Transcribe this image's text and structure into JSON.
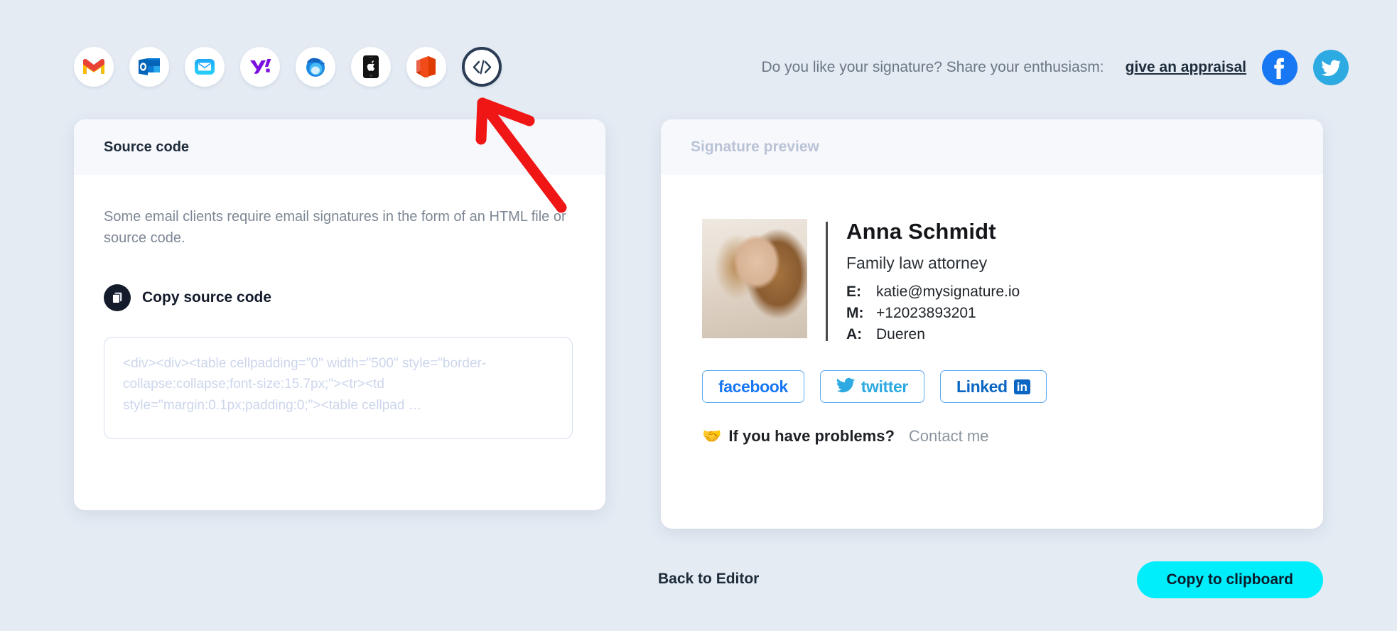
{
  "email_clients": [
    {
      "id": "gmail",
      "label": "Gmail",
      "selected": false
    },
    {
      "id": "outlook",
      "label": "Outlook",
      "selected": false
    },
    {
      "id": "apple-mail",
      "label": "Apple Mail",
      "selected": false
    },
    {
      "id": "yahoo",
      "label": "Yahoo Mail",
      "selected": false
    },
    {
      "id": "thunderbird",
      "label": "Thunderbird",
      "selected": false
    },
    {
      "id": "iphone",
      "label": "iPhone Mail",
      "selected": false
    },
    {
      "id": "office365",
      "label": "Office 365",
      "selected": false
    },
    {
      "id": "source-code",
      "label": "Source code",
      "selected": true
    }
  ],
  "share": {
    "prompt": "Do you like your signature? Share your enthusiasm:",
    "link_label": "give an appraisal",
    "socials": [
      "facebook",
      "twitter"
    ]
  },
  "source_card": {
    "header_title": "Source code",
    "description": "Some email clients require email signatures in the form of an HTML file or source code.",
    "copy_label": "Copy source code",
    "code_snippet": "<div><div><table cellpadding=\"0\" width=\"500\" style=\"border-collapse:collapse;font-size:15.7px;\"><tr><td style=\"margin:0.1px;padding:0;\"><table cellpad …"
  },
  "preview_card": {
    "header_title": "Signature preview",
    "signature": {
      "name": "Anna Schmidt",
      "role": "Family law attorney",
      "fields": [
        {
          "key": "E:",
          "value": "katie@mysignature.io"
        },
        {
          "key": "M:",
          "value": "+12023893201"
        },
        {
          "key": "A:",
          "value": "Dueren"
        }
      ],
      "social_buttons": [
        {
          "id": "facebook",
          "label": "facebook"
        },
        {
          "id": "twitter",
          "label": "twitter"
        },
        {
          "id": "linkedin",
          "label": "Linked",
          "badge": "in"
        }
      ],
      "help_emoji": "🤝",
      "help_text": "If you have problems?",
      "help_link": "Contact me"
    }
  },
  "footer": {
    "back_label": "Back to Editor",
    "copy_clipboard_label": "Copy to clipboard"
  },
  "colors": {
    "page_background": "#e4ebf3",
    "card_header": "#f7f8fc",
    "accent_cyan": "#00eefb",
    "dark_navy": "#1d2b3a",
    "annotation_red": "#f01616"
  }
}
